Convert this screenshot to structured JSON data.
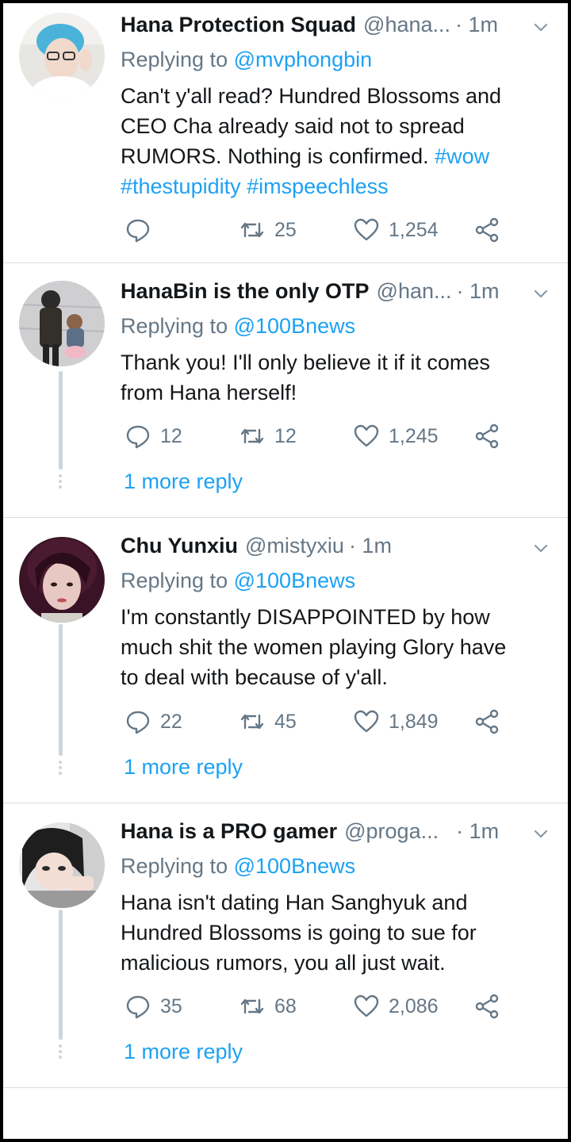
{
  "tweets": [
    {
      "name": "Hana Protection Squad",
      "handle": "@hana...",
      "time": "· 1m",
      "replying_prefix": "Replying to",
      "replying_to": "@mvphongbin",
      "text_lines": [
        {
          "plain": "Can't y'all read? Hundred Blossoms and",
          "tag": ""
        },
        {
          "plain": "CEO Cha already said not to spread",
          "tag": ""
        },
        {
          "plain": "RUMORS. Nothing is confirmed. ",
          "tag": "#wow"
        },
        {
          "plain": "",
          "tag": "#thestupidity #imspeechless"
        }
      ],
      "replies": "",
      "retweets": "25",
      "likes": "1,254",
      "more_reply": ""
    },
    {
      "name": "HanaBin is the only OTP",
      "handle": "@han...",
      "time": "· 1m",
      "replying_prefix": "Replying to",
      "replying_to": "@100Bnews",
      "text_lines": [
        {
          "plain": "Thank you! I'll only believe it if it comes",
          "tag": ""
        },
        {
          "plain": "from Hana herself!",
          "tag": ""
        }
      ],
      "replies": "12",
      "retweets": "12",
      "likes": "1,245",
      "more_reply": "1 more reply"
    },
    {
      "name": "Chu Yunxiu",
      "handle": "@mistyxiu",
      "time": "· 1m",
      "replying_prefix": "Replying to",
      "replying_to": "@100Bnews",
      "text_lines": [
        {
          "plain": "I'm constantly DISAPPOINTED by how",
          "tag": ""
        },
        {
          "plain": "much shit the women playing Glory have",
          "tag": ""
        },
        {
          "plain": "to deal with because of y'all.",
          "tag": ""
        }
      ],
      "replies": "22",
      "retweets": "45",
      "likes": "1,849",
      "more_reply": "1 more reply"
    },
    {
      "name": "Hana is a PRO gamer",
      "handle": "@proga...",
      "time": "· 1m",
      "replying_prefix": "Replying to",
      "replying_to": "@100Bnews",
      "text_lines": [
        {
          "plain": "Hana isn't dating Han Sanghyuk and",
          "tag": ""
        },
        {
          "plain": "Hundred Blossoms is going to sue for",
          "tag": ""
        },
        {
          "plain": "malicious rumors, you all just wait.",
          "tag": ""
        }
      ],
      "replies": "35",
      "retweets": "68",
      "likes": "2,086",
      "more_reply": "1 more reply"
    }
  ],
  "icons": {
    "reply": "reply-icon",
    "retweet": "retweet-icon",
    "like": "heart-icon",
    "share": "share-icon",
    "menu": "chevron-down-icon"
  },
  "colors": {
    "link": "#1da1f2",
    "muted": "#657786",
    "text": "#14171a",
    "divider": "#d8dde1",
    "thread": "#ccd6dd"
  }
}
